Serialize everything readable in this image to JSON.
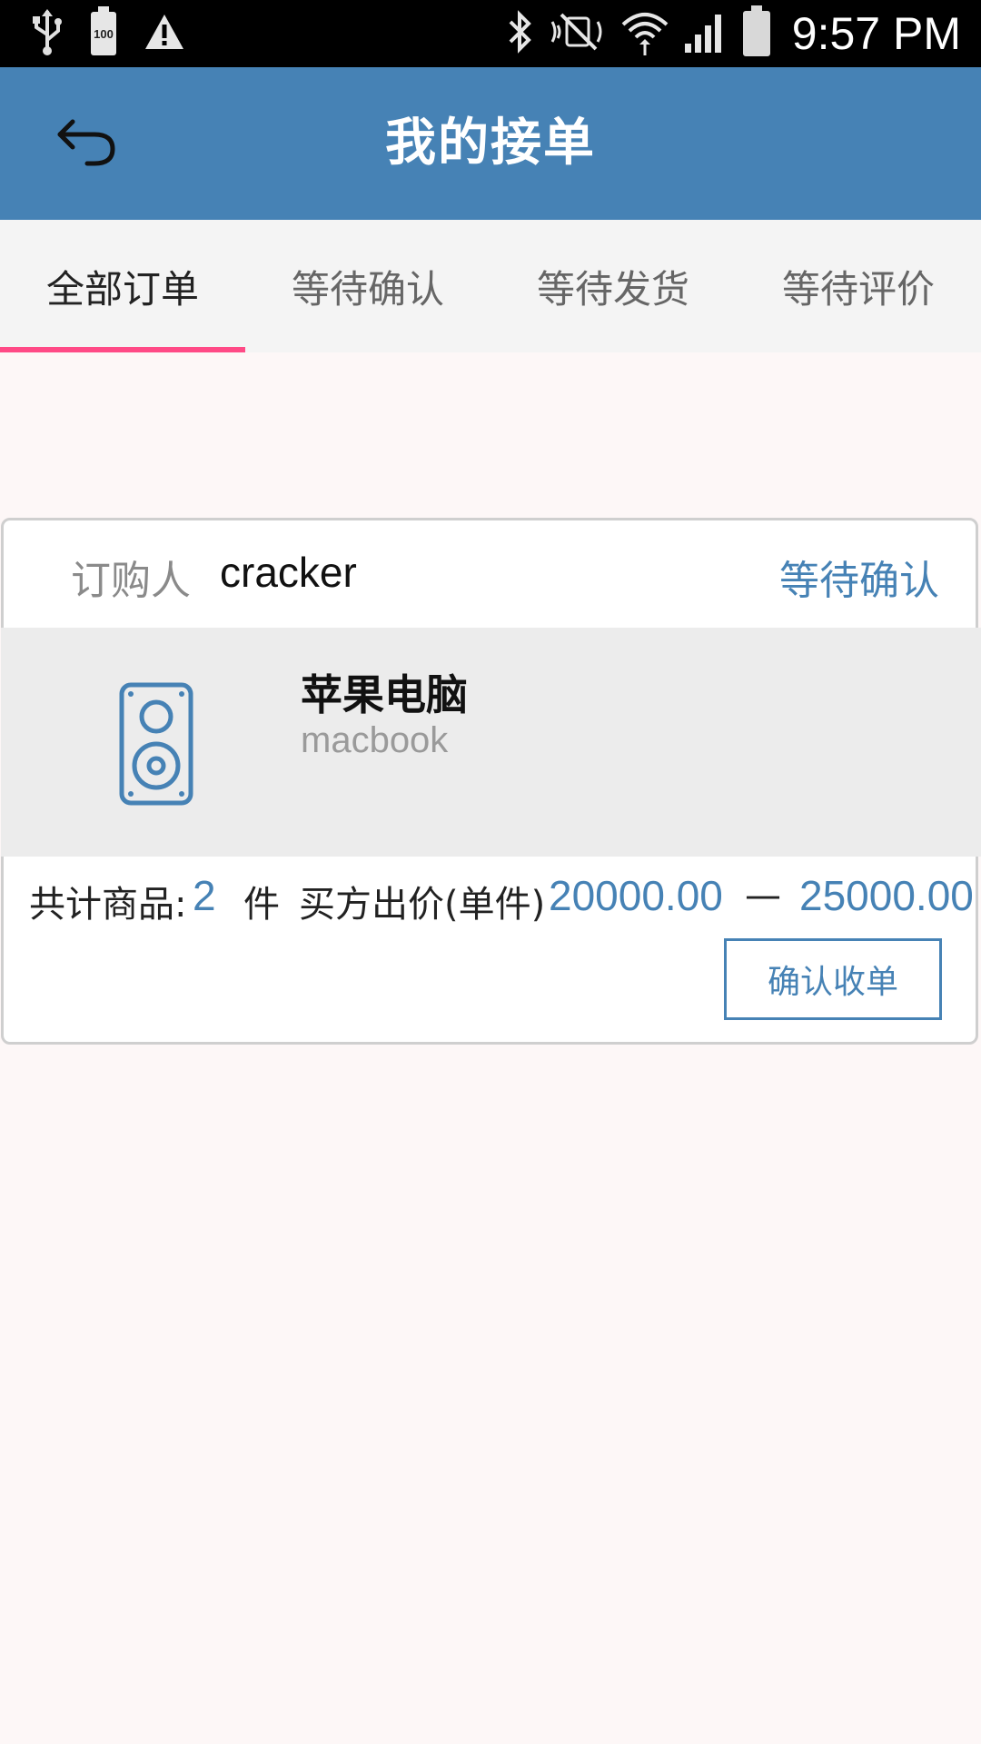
{
  "status_bar": {
    "battery_small_label": "100",
    "time": "9:57 PM",
    "icons": [
      "usb-icon",
      "battery-full-icon",
      "warning-icon",
      "bluetooth-icon",
      "vibrate-icon",
      "mute-icon",
      "wifi-icon",
      "signal-icon",
      "battery-icon"
    ]
  },
  "header": {
    "title": "我的接单",
    "back_icon": "back-arrow-icon"
  },
  "tabs": [
    {
      "label": "全部订单",
      "active": true
    },
    {
      "label": "等待确认",
      "active": false
    },
    {
      "label": "等待发货",
      "active": false
    },
    {
      "label": "等待评价",
      "active": false
    }
  ],
  "colors": {
    "header": "#4682b5",
    "tab_indicator": "#ff4a86",
    "accent": "#4682b5"
  },
  "order": {
    "buyer_label": "订购人",
    "buyer_name": "cracker",
    "status": "等待确认",
    "product": {
      "icon": "speaker-icon",
      "name": "苹果电脑",
      "description": "macbook"
    },
    "summary": {
      "total_label": "共计商品:",
      "total_count": "2",
      "unit": "件",
      "price_label": "买方出价(单件)",
      "price_min": "20000.00",
      "price_separator": "—",
      "price_max": "25000.00"
    },
    "confirm_button": "确认收单"
  }
}
